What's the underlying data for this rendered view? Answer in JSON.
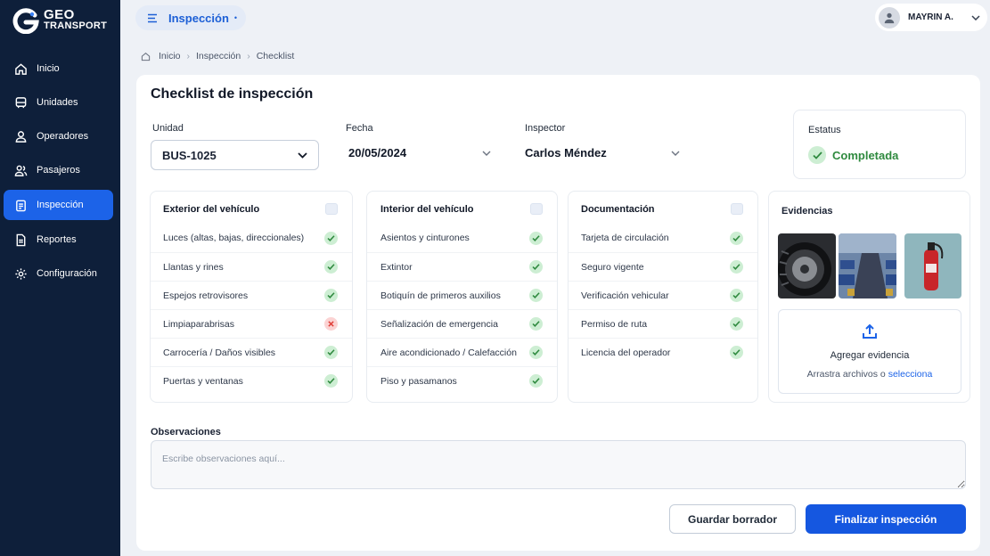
{
  "brand": {
    "line1": "GEO",
    "line2": "TRANSPORT"
  },
  "sidebar": {
    "items": [
      {
        "label": "Inicio",
        "icon": "home-icon"
      },
      {
        "label": "Unidades",
        "icon": "bus-icon"
      },
      {
        "label": "Operadores",
        "icon": "user-icon"
      },
      {
        "label": "Pasajeros",
        "icon": "users-icon"
      },
      {
        "label": "Inspección",
        "icon": "clipboard-icon",
        "active": true
      },
      {
        "label": "Reportes",
        "icon": "document-icon"
      },
      {
        "label": "Configuración",
        "icon": "gear-icon"
      }
    ]
  },
  "header": {
    "section": "Inspección",
    "user_name": "MAYRIN A."
  },
  "breadcrumb": [
    "Inicio",
    "Inspección",
    "Checklist"
  ],
  "page": {
    "title": "Checklist de inspección"
  },
  "fields": {
    "unidad": {
      "label": "Unidad",
      "value": "BUS-1025"
    },
    "fecha": {
      "label": "Fecha",
      "value": "20/05/2024"
    },
    "inspector": {
      "label": "Inspector",
      "value": "Carlos Méndez"
    }
  },
  "status": {
    "label": "Estatus",
    "value": "Completada",
    "color": "#2f8a3f"
  },
  "checklists": [
    {
      "title": "Exterior del vehículo",
      "items": [
        {
          "label": "Luces (altas, bajas, direccionales)",
          "ok": true
        },
        {
          "label": "Llantas y rines",
          "ok": true
        },
        {
          "label": "Espejos retrovisores",
          "ok": true
        },
        {
          "label": "Limpiaparabrisas",
          "ok": false
        },
        {
          "label": "Carrocería / Daños visibles",
          "ok": true
        },
        {
          "label": "Puertas y ventanas",
          "ok": true
        }
      ]
    },
    {
      "title": "Interior del vehículo",
      "items": [
        {
          "label": "Asientos y cinturones",
          "ok": true
        },
        {
          "label": "Extintor",
          "ok": true
        },
        {
          "label": "Botiquín de primeros auxilios",
          "ok": true
        },
        {
          "label": "Señalización de emergencia",
          "ok": true
        },
        {
          "label": "Aire acondicionado / Calefacción",
          "ok": true
        },
        {
          "label": "Piso y pasamanos",
          "ok": true
        }
      ]
    },
    {
      "title": "Documentación",
      "items": [
        {
          "label": "Tarjeta de circulación",
          "ok": true
        },
        {
          "label": "Seguro vigente",
          "ok": true
        },
        {
          "label": "Verificación vehicular",
          "ok": true
        },
        {
          "label": "Permiso de ruta",
          "ok": true
        },
        {
          "label": "Licencia del operador",
          "ok": true
        }
      ]
    }
  ],
  "evidence": {
    "title": "Evidencias",
    "photos": [
      "tire-photo",
      "bus-interior-photo",
      "fire-extinguisher-photo"
    ],
    "upload_title": "Agregar evidencia",
    "upload_hint": "Arrastra archivos o",
    "upload_link": "selecciona"
  },
  "observations": {
    "label": "Observaciones",
    "placeholder": "Escribe observaciones aquí..."
  },
  "actions": {
    "draft": "Guardar borrador",
    "finish": "Finalizar inspección"
  },
  "colors": {
    "sidebar": "#0e1f3a",
    "accent": "#1c63e8",
    "ok": "#2f8a3f",
    "error": "#e0403a"
  }
}
